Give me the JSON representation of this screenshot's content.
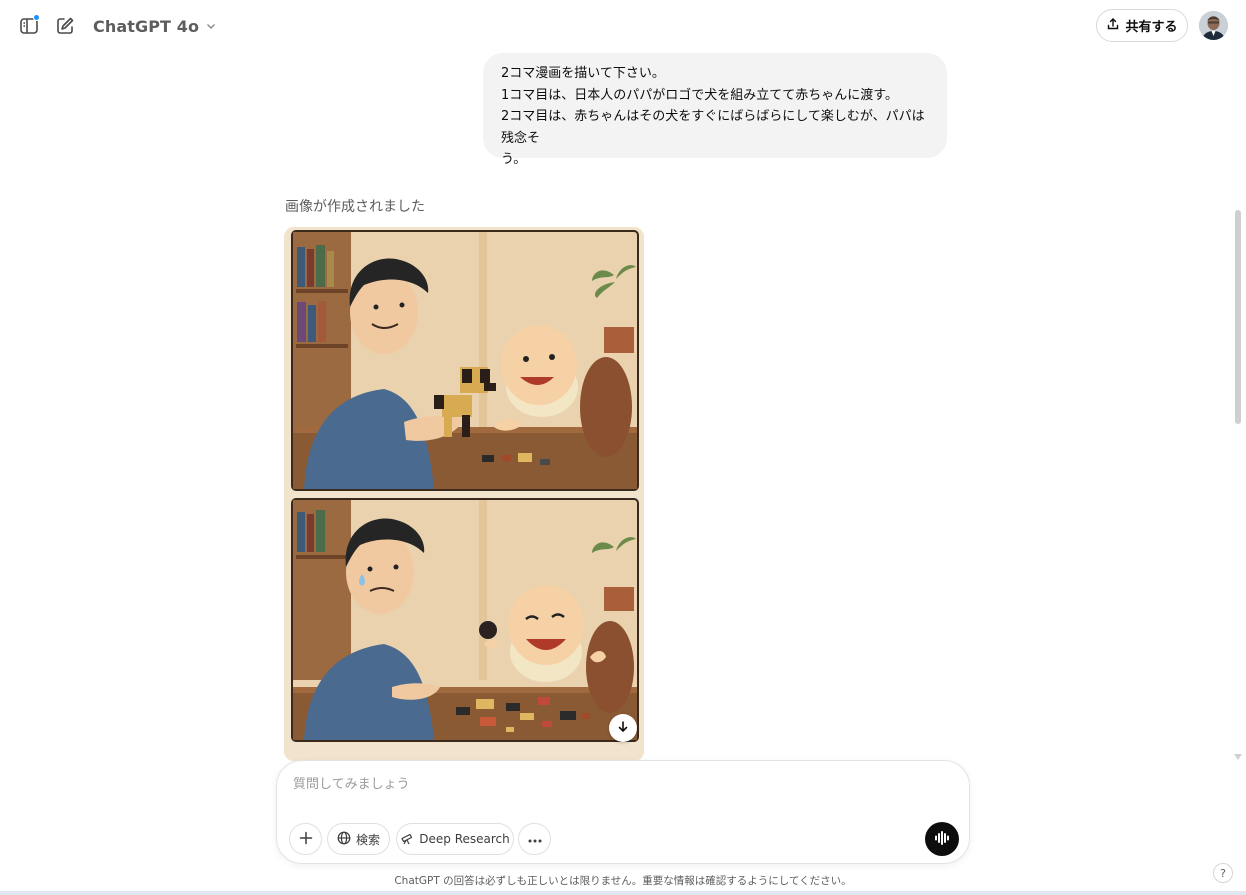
{
  "header": {
    "model_name": "ChatGPT 4o",
    "share_label": "共有する"
  },
  "conversation": {
    "user_message_lines": [
      "2コマ漫画を描いて下さい。",
      "1コマ目は、日本人のパパがロゴで犬を組み立てて赤ちゃんに渡す。",
      "2コマ目は、赤ちゃんはその犬をすぐにばらばらにして楽しむが、パパは残念そ",
      "う。"
    ],
    "assistant_status": "画像が作成されました"
  },
  "composer": {
    "placeholder": "質問してみましょう",
    "search_label": "検索",
    "deep_research_label": "Deep Research"
  },
  "footer": {
    "disclaimer": "ChatGPT の回答は必ずしも正しいとは限りません。重要な情報は確認するようにしてください。",
    "help_label": "?"
  },
  "icons": {
    "sidebar": "sidebar-toggle-icon",
    "new_chat": "edit-icon",
    "chevron": "chevron-down-icon",
    "share": "share-upload-icon",
    "download": "download-arrow-icon",
    "plus": "plus-icon",
    "globe": "globe-icon",
    "telescope": "telescope-icon",
    "more": "ellipsis-icon",
    "voice": "voice-waveform-icon"
  },
  "colors": {
    "user_bubble": "#f3f3f3",
    "notification_dot": "#1e90ff",
    "voice_button": "#0d0d0d"
  }
}
